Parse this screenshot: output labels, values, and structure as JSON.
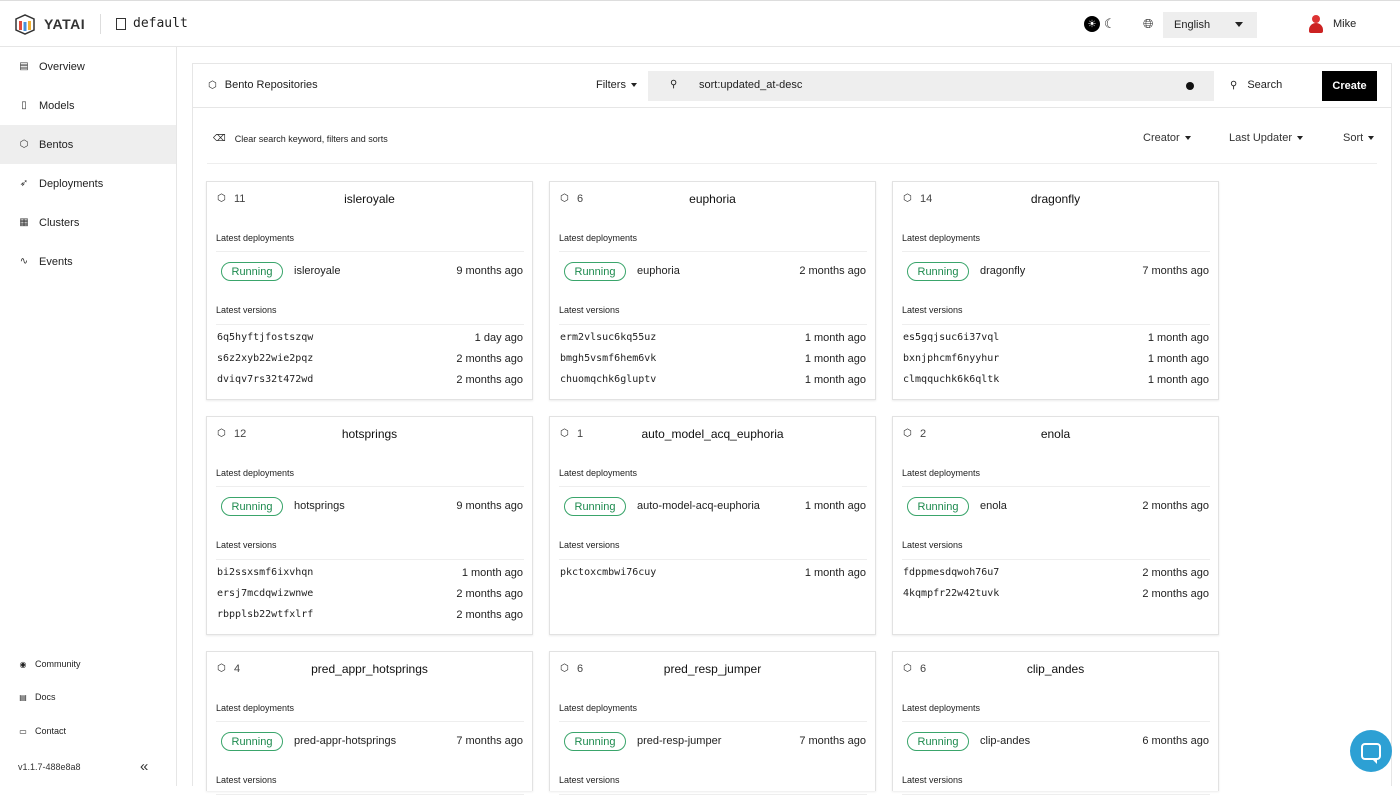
{
  "topbar": {
    "app_name": "YATAI",
    "org_name": "default",
    "language": "English",
    "user_name": "Mike"
  },
  "sidebar": {
    "items": [
      {
        "label": "Overview",
        "icon": "document-icon"
      },
      {
        "label": "Models",
        "icon": "file-icon"
      },
      {
        "label": "Bentos",
        "icon": "box-icon",
        "active": true
      },
      {
        "label": "Deployments",
        "icon": "rocket-icon"
      },
      {
        "label": "Clusters",
        "icon": "server-icon"
      },
      {
        "label": "Events",
        "icon": "activity-icon"
      }
    ],
    "footer": [
      {
        "label": "Community",
        "icon": "community-icon"
      },
      {
        "label": "Docs",
        "icon": "docs-icon"
      },
      {
        "label": "Contact",
        "icon": "contact-icon"
      }
    ],
    "version": "v1.1.7-488e8a8"
  },
  "panel": {
    "title": "Bento Repositories",
    "filters_label": "Filters",
    "search_value": "sort:updated_at-desc",
    "search_label": "Search",
    "create_label": "Create",
    "clear_label": "Clear search keyword, filters and sorts",
    "creator_label": "Creator",
    "last_updater_label": "Last Updater",
    "sort_label": "Sort"
  },
  "labels": {
    "latest_deployments": "Latest deployments",
    "latest_versions": "Latest versions"
  },
  "cards": [
    {
      "count": "11",
      "name": "isleroyale",
      "deployments": [
        {
          "status": "Running",
          "name": "isleroyale",
          "time": "9 months ago"
        }
      ],
      "versions": [
        {
          "id": "6q5hyftjfostszqw",
          "time": "1 day ago"
        },
        {
          "id": "s6z2xyb22wie2pqz",
          "time": "2 months ago"
        },
        {
          "id": "dviqv7rs32t472wd",
          "time": "2 months ago"
        }
      ]
    },
    {
      "count": "6",
      "name": "euphoria",
      "deployments": [
        {
          "status": "Running",
          "name": "euphoria",
          "time": "2 months ago"
        }
      ],
      "versions": [
        {
          "id": "erm2vlsuc6kq55uz",
          "time": "1 month ago"
        },
        {
          "id": "bmgh5vsmf6hem6vk",
          "time": "1 month ago"
        },
        {
          "id": "chuomqchk6gluptv",
          "time": "1 month ago"
        }
      ]
    },
    {
      "count": "14",
      "name": "dragonfly",
      "deployments": [
        {
          "status": "Running",
          "name": "dragonfly",
          "time": "7 months ago"
        }
      ],
      "versions": [
        {
          "id": "es5gqjsuc6i37vql",
          "time": "1 month ago"
        },
        {
          "id": "bxnjphcmf6nyyhur",
          "time": "1 month ago"
        },
        {
          "id": "clmqquchk6k6qltk",
          "time": "1 month ago"
        }
      ]
    },
    {
      "count": "12",
      "name": "hotsprings",
      "deployments": [
        {
          "status": "Running",
          "name": "hotsprings",
          "time": "9 months ago"
        }
      ],
      "versions": [
        {
          "id": "bi2ssxsmf6ixvhqn",
          "time": "1 month ago"
        },
        {
          "id": "ersj7mcdqwizwnwe",
          "time": "2 months ago"
        },
        {
          "id": "rbpplsb22wtfxlrf",
          "time": "2 months ago"
        }
      ]
    },
    {
      "count": "1",
      "name": "auto_model_acq_euphoria",
      "deployments": [
        {
          "status": "Running",
          "name": "auto-model-acq-euphoria",
          "time": "1 month ago"
        }
      ],
      "versions": [
        {
          "id": "pkctoxcmbwi76cuy",
          "time": "1 month ago"
        }
      ]
    },
    {
      "count": "2",
      "name": "enola",
      "deployments": [
        {
          "status": "Running",
          "name": "enola",
          "time": "2 months ago"
        }
      ],
      "versions": [
        {
          "id": "fdppmesdqwoh76u7",
          "time": "2 months ago"
        },
        {
          "id": "4kqmpfr22w42tuvk",
          "time": "2 months ago"
        }
      ]
    },
    {
      "count": "4",
      "name": "pred_appr_hotsprings",
      "deployments": [
        {
          "status": "Running",
          "name": "pred-appr-hotsprings",
          "time": "7 months ago"
        }
      ],
      "versions": []
    },
    {
      "count": "6",
      "name": "pred_resp_jumper",
      "deployments": [
        {
          "status": "Running",
          "name": "pred-resp-jumper",
          "time": "7 months ago"
        }
      ],
      "versions": []
    },
    {
      "count": "6",
      "name": "clip_andes",
      "deployments": [
        {
          "status": "Running",
          "name": "clip-andes",
          "time": "6 months ago"
        }
      ],
      "versions": []
    }
  ],
  "colors": {
    "running_green": "#3aa56b",
    "chat_blue": "#2da0d4",
    "create_black": "#000000"
  }
}
